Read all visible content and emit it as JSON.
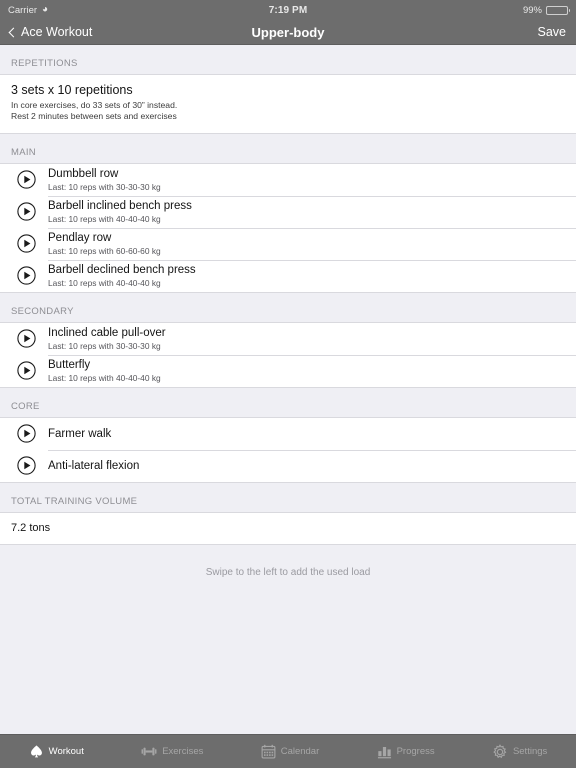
{
  "status_bar": {
    "carrier": "Carrier",
    "wifi_icon": "wifi-icon",
    "time": "7:19 PM",
    "battery_percent": "99%",
    "battery_level": 99,
    "battery_color": "#4cd964"
  },
  "nav_bar": {
    "back_label": "Ace Workout",
    "back_icon": "chevron-left-icon",
    "title": "Upper-body",
    "save_label": "Save",
    "background_color": "#6d6d6d"
  },
  "sections": [
    {
      "header": "REPETITIONS",
      "type": "info",
      "title": "3 sets x 10 repetitions",
      "lines": [
        "In core exercises, do 33 sets of 30” instead.",
        "Rest 2 minutes between sets and exercises"
      ]
    },
    {
      "header": "MAIN",
      "type": "exercises",
      "rows": [
        {
          "title": "Dumbbell row",
          "subtitle": "Last: 10 reps with 30-30-30 kg",
          "icon": "play-icon"
        },
        {
          "title": "Barbell inclined bench press",
          "subtitle": "Last: 10 reps with 40-40-40 kg",
          "icon": "play-icon"
        },
        {
          "title": "Pendlay row",
          "subtitle": "Last: 10 reps with 60-60-60 kg",
          "icon": "play-icon"
        },
        {
          "title": "Barbell declined bench press",
          "subtitle": "Last: 10 reps with 40-40-40 kg",
          "icon": "play-icon"
        }
      ]
    },
    {
      "header": "SECONDARY",
      "type": "exercises",
      "rows": [
        {
          "title": "Inclined cable pull-over",
          "subtitle": "Last: 10 reps with 30-30-30 kg",
          "icon": "play-icon"
        },
        {
          "title": "Butterfly",
          "subtitle": "Last: 10 reps with 40-40-40 kg",
          "icon": "play-icon"
        }
      ]
    },
    {
      "header": "CORE",
      "type": "exercises",
      "rows": [
        {
          "title": "Farmer walk",
          "subtitle": "",
          "icon": "play-icon"
        },
        {
          "title": "Anti-lateral flexion",
          "subtitle": "",
          "icon": "play-icon"
        }
      ]
    },
    {
      "header": "TOTAL TRAINING VOLUME",
      "type": "value",
      "value": "7.2 tons"
    }
  ],
  "swipe_hint": "Swipe to the left to add the used load",
  "tab_bar": {
    "items": [
      {
        "label": "Workout",
        "icon": "spade-icon",
        "active": true
      },
      {
        "label": "Exercises",
        "icon": "dumbbell-icon",
        "active": false
      },
      {
        "label": "Calendar",
        "icon": "calendar-icon",
        "active": false
      },
      {
        "label": "Progress",
        "icon": "bar-chart-icon",
        "active": false
      },
      {
        "label": "Settings",
        "icon": "gear-icon",
        "active": false
      }
    ],
    "active_color": "#ffffff",
    "inactive_color": "#a6a6a6"
  }
}
